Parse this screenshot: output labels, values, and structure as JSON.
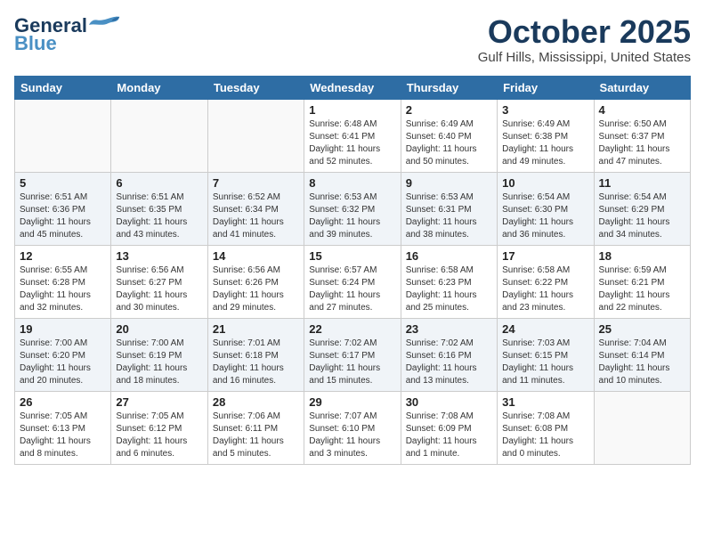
{
  "header": {
    "logo_line1": "General",
    "logo_line2": "Blue",
    "month_title": "October 2025",
    "location": "Gulf Hills, Mississippi, United States"
  },
  "weekdays": [
    "Sunday",
    "Monday",
    "Tuesday",
    "Wednesday",
    "Thursday",
    "Friday",
    "Saturday"
  ],
  "weeks": [
    [
      {
        "day": "",
        "info": ""
      },
      {
        "day": "",
        "info": ""
      },
      {
        "day": "",
        "info": ""
      },
      {
        "day": "1",
        "info": "Sunrise: 6:48 AM\nSunset: 6:41 PM\nDaylight: 11 hours\nand 52 minutes."
      },
      {
        "day": "2",
        "info": "Sunrise: 6:49 AM\nSunset: 6:40 PM\nDaylight: 11 hours\nand 50 minutes."
      },
      {
        "day": "3",
        "info": "Sunrise: 6:49 AM\nSunset: 6:38 PM\nDaylight: 11 hours\nand 49 minutes."
      },
      {
        "day": "4",
        "info": "Sunrise: 6:50 AM\nSunset: 6:37 PM\nDaylight: 11 hours\nand 47 minutes."
      }
    ],
    [
      {
        "day": "5",
        "info": "Sunrise: 6:51 AM\nSunset: 6:36 PM\nDaylight: 11 hours\nand 45 minutes."
      },
      {
        "day": "6",
        "info": "Sunrise: 6:51 AM\nSunset: 6:35 PM\nDaylight: 11 hours\nand 43 minutes."
      },
      {
        "day": "7",
        "info": "Sunrise: 6:52 AM\nSunset: 6:34 PM\nDaylight: 11 hours\nand 41 minutes."
      },
      {
        "day": "8",
        "info": "Sunrise: 6:53 AM\nSunset: 6:32 PM\nDaylight: 11 hours\nand 39 minutes."
      },
      {
        "day": "9",
        "info": "Sunrise: 6:53 AM\nSunset: 6:31 PM\nDaylight: 11 hours\nand 38 minutes."
      },
      {
        "day": "10",
        "info": "Sunrise: 6:54 AM\nSunset: 6:30 PM\nDaylight: 11 hours\nand 36 minutes."
      },
      {
        "day": "11",
        "info": "Sunrise: 6:54 AM\nSunset: 6:29 PM\nDaylight: 11 hours\nand 34 minutes."
      }
    ],
    [
      {
        "day": "12",
        "info": "Sunrise: 6:55 AM\nSunset: 6:28 PM\nDaylight: 11 hours\nand 32 minutes."
      },
      {
        "day": "13",
        "info": "Sunrise: 6:56 AM\nSunset: 6:27 PM\nDaylight: 11 hours\nand 30 minutes."
      },
      {
        "day": "14",
        "info": "Sunrise: 6:56 AM\nSunset: 6:26 PM\nDaylight: 11 hours\nand 29 minutes."
      },
      {
        "day": "15",
        "info": "Sunrise: 6:57 AM\nSunset: 6:24 PM\nDaylight: 11 hours\nand 27 minutes."
      },
      {
        "day": "16",
        "info": "Sunrise: 6:58 AM\nSunset: 6:23 PM\nDaylight: 11 hours\nand 25 minutes."
      },
      {
        "day": "17",
        "info": "Sunrise: 6:58 AM\nSunset: 6:22 PM\nDaylight: 11 hours\nand 23 minutes."
      },
      {
        "day": "18",
        "info": "Sunrise: 6:59 AM\nSunset: 6:21 PM\nDaylight: 11 hours\nand 22 minutes."
      }
    ],
    [
      {
        "day": "19",
        "info": "Sunrise: 7:00 AM\nSunset: 6:20 PM\nDaylight: 11 hours\nand 20 minutes."
      },
      {
        "day": "20",
        "info": "Sunrise: 7:00 AM\nSunset: 6:19 PM\nDaylight: 11 hours\nand 18 minutes."
      },
      {
        "day": "21",
        "info": "Sunrise: 7:01 AM\nSunset: 6:18 PM\nDaylight: 11 hours\nand 16 minutes."
      },
      {
        "day": "22",
        "info": "Sunrise: 7:02 AM\nSunset: 6:17 PM\nDaylight: 11 hours\nand 15 minutes."
      },
      {
        "day": "23",
        "info": "Sunrise: 7:02 AM\nSunset: 6:16 PM\nDaylight: 11 hours\nand 13 minutes."
      },
      {
        "day": "24",
        "info": "Sunrise: 7:03 AM\nSunset: 6:15 PM\nDaylight: 11 hours\nand 11 minutes."
      },
      {
        "day": "25",
        "info": "Sunrise: 7:04 AM\nSunset: 6:14 PM\nDaylight: 11 hours\nand 10 minutes."
      }
    ],
    [
      {
        "day": "26",
        "info": "Sunrise: 7:05 AM\nSunset: 6:13 PM\nDaylight: 11 hours\nand 8 minutes."
      },
      {
        "day": "27",
        "info": "Sunrise: 7:05 AM\nSunset: 6:12 PM\nDaylight: 11 hours\nand 6 minutes."
      },
      {
        "day": "28",
        "info": "Sunrise: 7:06 AM\nSunset: 6:11 PM\nDaylight: 11 hours\nand 5 minutes."
      },
      {
        "day": "29",
        "info": "Sunrise: 7:07 AM\nSunset: 6:10 PM\nDaylight: 11 hours\nand 3 minutes."
      },
      {
        "day": "30",
        "info": "Sunrise: 7:08 AM\nSunset: 6:09 PM\nDaylight: 11 hours\nand 1 minute."
      },
      {
        "day": "31",
        "info": "Sunrise: 7:08 AM\nSunset: 6:08 PM\nDaylight: 11 hours\nand 0 minutes."
      },
      {
        "day": "",
        "info": ""
      }
    ]
  ]
}
